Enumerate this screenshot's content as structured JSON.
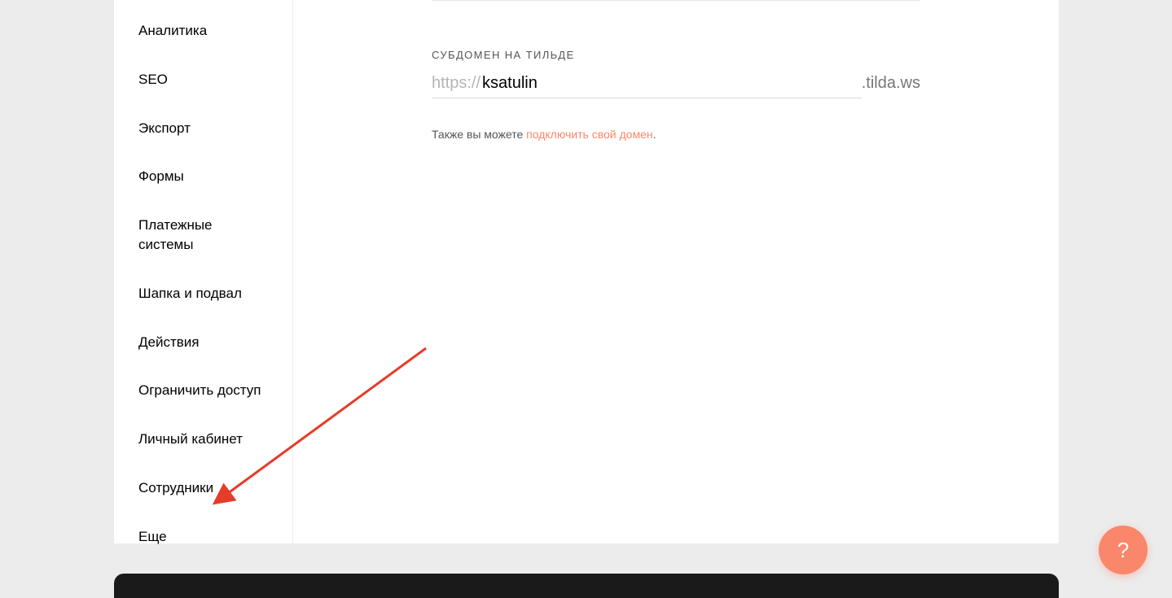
{
  "sidebar": {
    "items": [
      {
        "label": "Аналитика"
      },
      {
        "label": "SEO"
      },
      {
        "label": "Экспорт"
      },
      {
        "label": "Формы"
      },
      {
        "label": "Платежные системы"
      },
      {
        "label": "Шапка и подвал"
      },
      {
        "label": "Действия"
      },
      {
        "label": "Ограничить доступ"
      },
      {
        "label": "Личный кабинет"
      },
      {
        "label": "Сотрудники"
      },
      {
        "label": "Еще"
      }
    ]
  },
  "main": {
    "subdomain_label": "СУБДОМЕН НА ТИЛЬДЕ",
    "protocol": "https://",
    "subdomain_value": "ksatulin",
    "suffix": ".tilda.ws",
    "hint_prefix": "Также вы можете ",
    "hint_link": "подключить свой домен",
    "hint_suffix": "."
  },
  "help": {
    "label": "?"
  },
  "colors": {
    "accent": "#fa876b",
    "arrow": "#e63c2a"
  }
}
